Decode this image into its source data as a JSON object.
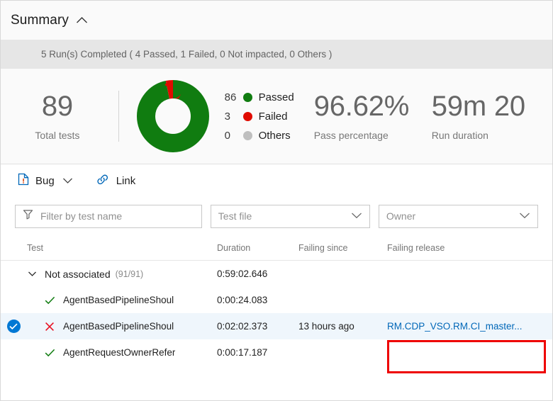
{
  "summary": {
    "title": "Summary",
    "collapse_icon": "chevron-up-icon",
    "run_status": "5 Run(s) Completed ( 4 Passed, 1 Failed, 0 Not impacted, 0 Others )"
  },
  "metrics": {
    "total_tests": {
      "value": "89",
      "label": "Total tests"
    },
    "pass_percentage": {
      "value": "96.62%",
      "label": "Pass percentage"
    },
    "run_duration": {
      "value": "59m 20",
      "label": "Run duration"
    },
    "legend": [
      {
        "count": "86",
        "label": "Passed",
        "color": "#107c10"
      },
      {
        "count": "3",
        "label": "Failed",
        "color": "#e00b00"
      },
      {
        "count": "0",
        "label": "Others",
        "color": "#bfbfbf"
      }
    ]
  },
  "chart_data": {
    "type": "pie",
    "title": "Test outcome distribution",
    "categories": [
      "Passed",
      "Failed",
      "Others"
    ],
    "values": [
      86,
      3,
      0
    ],
    "colors": [
      "#107c10",
      "#e00b00",
      "#bfbfbf"
    ],
    "total": 89,
    "donut": true,
    "legend_position": "right"
  },
  "toolbar": {
    "bug_label": "Bug",
    "bug_icon": "bug-page-icon",
    "bug_caret_icon": "chevron-down-icon",
    "link_label": "Link",
    "link_icon": "link-icon"
  },
  "filters": {
    "search": {
      "placeholder": "Filter by test name",
      "value": "",
      "icon": "filter-icon"
    },
    "test_file": {
      "label": "Test file",
      "caret_icon": "chevron-down-icon"
    },
    "owner": {
      "label": "Owner",
      "caret_icon": "chevron-down-icon"
    }
  },
  "table": {
    "columns": [
      "Test",
      "Duration",
      "Failing since",
      "Failing release"
    ],
    "rows": [
      {
        "type": "group",
        "name": "Not associated",
        "count": "(91/91)",
        "duration": "0:59:02.646",
        "failing_since": "",
        "failing_release": "",
        "expanded": true,
        "selected": false,
        "status": ""
      },
      {
        "type": "test",
        "name": "AgentBasedPipelineShoul",
        "duration": "0:00:24.083",
        "failing_since": "",
        "failing_release": "",
        "selected": false,
        "status": "passed"
      },
      {
        "type": "test",
        "name": "AgentBasedPipelineShoul",
        "duration": "0:02:02.373",
        "failing_since": "13 hours ago",
        "failing_release": "RM.CDP_VSO.RM.CI_master...",
        "selected": true,
        "status": "failed"
      },
      {
        "type": "test",
        "name": "AgentRequestOwnerRefer",
        "duration": "0:00:17.187",
        "failing_since": "",
        "failing_release": "",
        "selected": false,
        "status": "passed"
      }
    ]
  },
  "annotation": {
    "highlight_color": "#ee0000",
    "target": "failing-release-link"
  }
}
